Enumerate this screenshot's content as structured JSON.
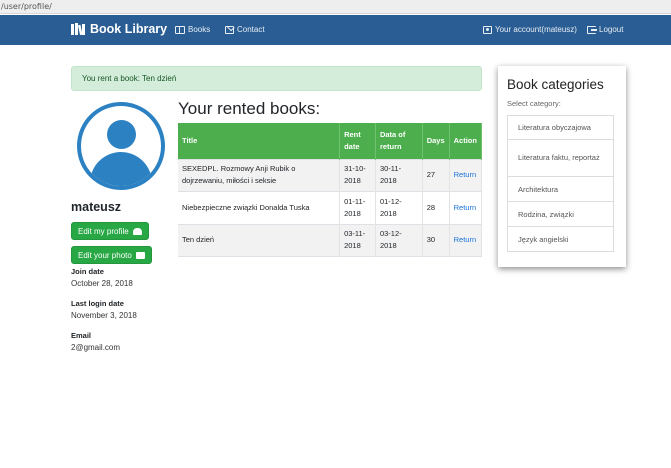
{
  "browser": {
    "url": "/user/profile/"
  },
  "nav": {
    "brand": "Book Library",
    "books": "Books",
    "contact": "Contact",
    "account": "Your account(mateusz)",
    "logout": "Logout"
  },
  "alert": "You rent a book: Ten dzień",
  "profile": {
    "username": "mateusz",
    "edit_profile": "Edit my profile",
    "edit_photo": "Edit your photo",
    "join_label": "Join date",
    "join_value": "October 28, 2018",
    "login_label": "Last login date",
    "login_value": "November 3, 2018",
    "email_label": "Email",
    "email_value": "2@gmail.com"
  },
  "rented": {
    "title": "Your rented books:",
    "headers": [
      "Title",
      "Rent date",
      "Data of return",
      "Days",
      "Action"
    ],
    "rows": [
      {
        "title": "SEXEDPL. Rozmowy Anji Rubik o dojrzewaniu, miłości i seksie",
        "rent": "31-10-2018",
        "ret": "30-11-2018",
        "days": "27",
        "action": "Return"
      },
      {
        "title": "Niebezpieczne związki Donalda Tuska",
        "rent": "01-11-2018",
        "ret": "01-12-2018",
        "days": "28",
        "action": "Return"
      },
      {
        "title": "Ten dzień",
        "rent": "03-11-2018",
        "ret": "03-12-2018",
        "days": "30",
        "action": "Return"
      }
    ]
  },
  "categories": {
    "title": "Book categories",
    "subtitle": "Select category:",
    "items": [
      "Literatura obyczajowa",
      "Literatura faktu, reportaż",
      "Architektura",
      "Rodzina, związki",
      "Język angielski"
    ]
  },
  "colors": {
    "navbar": "#2a5d93",
    "success": "#28a745",
    "table_header": "#4cae4c",
    "alert_bg": "#d4edda",
    "avatar": "#2c81c2",
    "link": "#1a73d9"
  }
}
